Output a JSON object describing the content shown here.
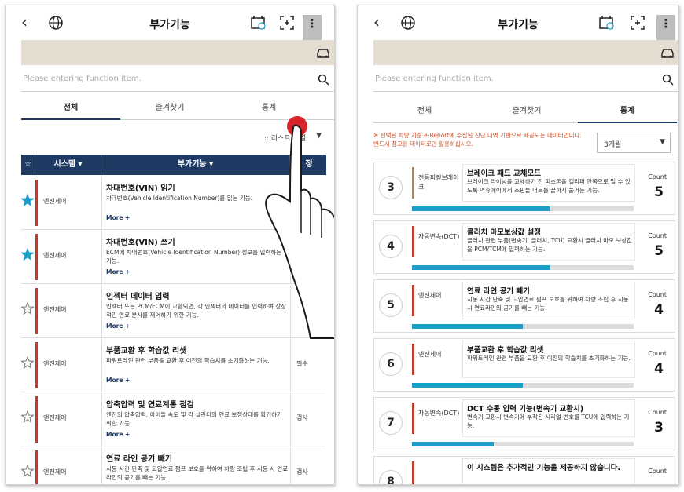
{
  "common": {
    "title": "부가기능",
    "back_icon": "chevron-left-icon",
    "search_placeholder": "Please entering function item.",
    "tabs": [
      "전체",
      "즐겨찾기",
      "통계"
    ]
  },
  "left": {
    "active_tab": 0,
    "sort_label": ":: 리스트 정렬",
    "table_headers": {
      "star": "☆",
      "system": "시스템",
      "function": "부가기능",
      "extra": "정"
    },
    "rows": [
      {
        "favorite": true,
        "system": "엔진제어",
        "name": "차대번호(VIN) 읽기",
        "desc": "차대번호(Vehicle Identification Number)를 읽는 기능.",
        "more": "More +",
        "extra": ""
      },
      {
        "favorite": true,
        "system": "엔진제어",
        "name": "차대번호(VIN) 쓰기",
        "desc": "ECM에 차대번호(Vehicle Identification Number) 정보를 입력하는 기능.",
        "more": "More +",
        "extra": ""
      },
      {
        "favorite": false,
        "system": "엔진제어",
        "name": "인젝터 데이터 입력",
        "desc": "인젝터 또는 PCM/ECM이 교환되면, 각 인젝터의 데이터를 입력하여 상상적인 연료 분사를 제어하기 위한 기능.",
        "more": "More +",
        "extra": ""
      },
      {
        "favorite": false,
        "system": "엔진제어",
        "name": "부품교환 후 학습값 리셋",
        "desc": "파워트레인 관련 부품을 교환 후 이전의 학습치를 초기화하는 기능.",
        "more": "More +",
        "extra": "필수"
      },
      {
        "favorite": false,
        "system": "엔진제어",
        "name": "압축압력 및 연료계통 점검",
        "desc": "엔진의 압축압력, 아이들 속도 및 각 실린더의 연료 보정상태를 확인하기 위한 기능.",
        "more": "More +",
        "extra": "검사"
      },
      {
        "favorite": false,
        "system": "엔진제어",
        "name": "연료 라인 공기 빼기",
        "desc": "시동 시간 단축 및 고압연료 펌프 보호를 위하여 차량 조립 후 시동 시 연료라인의 공기를 빼는 기능.",
        "more": "",
        "extra": "검사"
      }
    ]
  },
  "right": {
    "active_tab": 2,
    "notice": "※ 선택된 차량 기준 e-Report에 수집된 진단 내역 기반으로 제공되는 데이터입니다. 반드시 참고용 데이터로만 활용하십시오.",
    "period": "3개월",
    "count_label": "Count",
    "stats": [
      {
        "rank": "3",
        "system": "전동파킹브레이크",
        "name": "브레이크 패드 교체모드",
        "desc": "브레이크 라이닝을 교체하기 전 피스톤을 캘리퍼 안쪽으로 밀 수 있도록 역휴에이에서 스핀들 너트를 끝까지 풀거는 기능.",
        "count": "5",
        "progress": 0.62,
        "bar_color": "#9c8a6e"
      },
      {
        "rank": "4",
        "system": "자동변속(DCT)",
        "name": "클러치 마모보상값 설정",
        "desc": "클러치 관련 부품(변속기, 클러치, TCU) 교환시 클러치 마모 보상값을 PCM/TCM에 입력하는 기능.",
        "count": "5",
        "progress": 0.62,
        "bar_color": "#c0392b"
      },
      {
        "rank": "5",
        "system": "엔진제어",
        "name": "연료 라인 공기 빼기",
        "desc": "시동 시간 단축 및 고압연료 펌프 보호를 위하여 차량 조립 후 시동 시 연료라인의 공기를 빼는 기능.",
        "count": "4",
        "progress": 0.5,
        "bar_color": "#c0392b"
      },
      {
        "rank": "6",
        "system": "엔진제어",
        "name": "부품교환 후 학습값 리셋",
        "desc": "파워트레인 관련 부품을 교환 후 이전의 학습치를 초기화하는 기능.",
        "count": "4",
        "progress": 0.5,
        "bar_color": "#c0392b"
      },
      {
        "rank": "7",
        "system": "자동변속(DCT)",
        "name": "DCT 수동 입력 기능(변속기 교환시)",
        "desc": "변속기 교환시 변속기에 부착된 시리얼 번호를 TCU에 입력하는 기능.",
        "count": "3",
        "progress": 0.37,
        "bar_color": "#c0392b"
      },
      {
        "rank": "8",
        "system": "",
        "name": "이 시스템은 추가적인 기능을 제공하지 않습니다.",
        "desc": "",
        "count": "",
        "progress": 0,
        "bar_color": "#c0392b"
      }
    ]
  }
}
